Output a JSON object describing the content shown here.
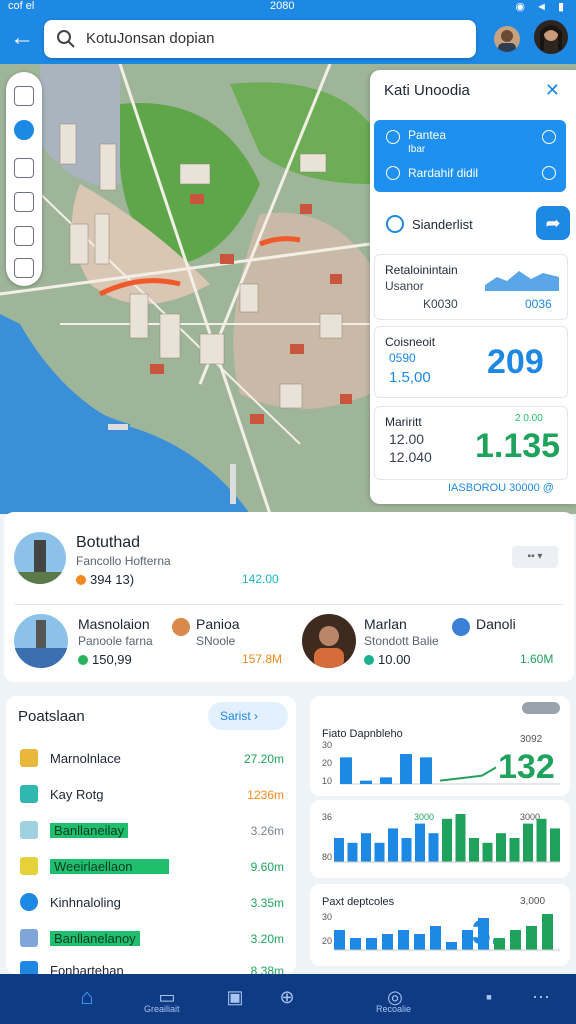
{
  "status": {
    "carrier": "cof el",
    "time": "2080",
    "icons": "◉ ◄ ▮"
  },
  "search": {
    "text": "KotuJonsan dopian"
  },
  "toolbar_icons": [
    "store-icon",
    "chat-icon",
    "shield-icon",
    "history-icon",
    "location-icon",
    "camera-icon"
  ],
  "right_panel": {
    "title": "Kati Unoodia",
    "blue_row1": "Pantea",
    "blue_row1_sub": "Ibar",
    "blue_row2": "Rardahif didil",
    "standard_label": "Sianderlist",
    "card1": {
      "title": "Retaloinintain",
      "sub": "Usanor",
      "value": "K0030",
      "value2": "0036"
    },
    "card2": {
      "title": "Coisneoit",
      "line1": "0590",
      "line2": "1.5,00",
      "big": "209"
    },
    "card3": {
      "title": "Mariritt",
      "tag": "2 0.00",
      "line1": "12.00",
      "line2": "12.040",
      "big": "1.135"
    },
    "footer": "IASBOROU 30000 @"
  },
  "places": {
    "row1": {
      "name": "Botuthad",
      "sub": "Fancollo Hofterna",
      "value": "394 13)",
      "extra": "142.00"
    },
    "row2": [
      {
        "name": "Masnolaion",
        "sub": "Panoole farna",
        "value": "150,99",
        "extra": "157.8M"
      },
      {
        "name": "Panioa",
        "sub": "SNoole"
      },
      {
        "name": "Marlan",
        "sub": "Stondott Balie",
        "value": "10.00",
        "extra": "1.60M"
      },
      {
        "name": "Danoli",
        "sub": ""
      }
    ]
  },
  "list": {
    "title": "Poatslaan",
    "button": "Sarist",
    "items": [
      {
        "name": "Marnolnlace",
        "value": "27.20m"
      },
      {
        "name": "Kay Rotg",
        "value": "1236m"
      },
      {
        "name": "Banllaneilay",
        "value": "3.26m"
      },
      {
        "name": "Weeirlaellaon",
        "value": "9.60m"
      },
      {
        "name": "Kinhnaloling",
        "value": "3.35m"
      },
      {
        "name": "Banllanelanoy",
        "value": "3.20m"
      },
      {
        "name": "Fonhartehan",
        "value": "8.38m"
      }
    ]
  },
  "chart_data": [
    {
      "type": "bar",
      "title": "Fiato Dapnbleho",
      "ylabel": "",
      "ylim": [
        0,
        30
      ],
      "axis_labels": [
        "30",
        "20",
        "10"
      ],
      "bars": [
        16,
        2,
        4,
        18,
        16
      ],
      "line_values": [
        2,
        3,
        4,
        5,
        10
      ],
      "tag": "3092",
      "big": "132"
    },
    {
      "type": "bar",
      "title": "",
      "ylim": [
        0,
        10
      ],
      "axis_labels": [
        "36",
        "80"
      ],
      "values": [
        5,
        4,
        6,
        4,
        7,
        5,
        8,
        6,
        9,
        10,
        5,
        4,
        6,
        5,
        8,
        9,
        7
      ],
      "tag": "3000",
      "tag2": "3000"
    },
    {
      "type": "bar",
      "title": "Paxt deptcoles",
      "ylim": [
        0,
        10
      ],
      "axis_labels": [
        "30",
        "20"
      ],
      "values": [
        5,
        3,
        3,
        4,
        5,
        4,
        6,
        2,
        5,
        8,
        3,
        5,
        6,
        9
      ],
      "tag": "3,000",
      "big": "3."
    }
  ],
  "chart_header_tag": "",
  "bottom_nav": {
    "labels": [
      "",
      "Greailiait",
      "",
      "",
      "Recoalie",
      "",
      ""
    ]
  }
}
